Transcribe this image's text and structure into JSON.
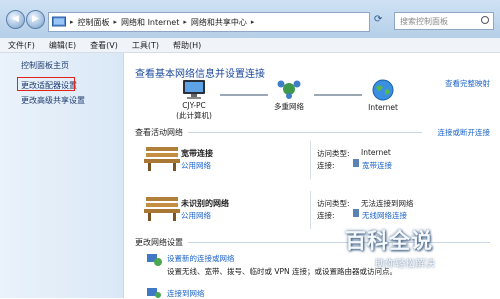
{
  "address_bar": {
    "breadcrumbs": [
      "控制面板",
      "网络和 Internet",
      "网络和共享中心"
    ],
    "search_placeholder": "搜索控制面板"
  },
  "menubar": [
    "文件(F)",
    "编辑(E)",
    "查看(V)",
    "工具(T)",
    "帮助(H)"
  ],
  "sidebar": {
    "items": [
      "控制面板主页",
      "更改适配器设置",
      "更改高级共享设置"
    ]
  },
  "main": {
    "title": "查看基本网络信息并设置连接",
    "full_map_link": "查看完整映射",
    "map": {
      "pc_name": "CJY-PC",
      "pc_sub": "(此计算机)",
      "network": "多重网络",
      "internet": "Internet"
    },
    "active_section": "查看活动网络",
    "connect_link": "连接或断开连接",
    "networks": [
      {
        "name": "宽带连接",
        "type": "公用网络",
        "access_label": "访问类型:",
        "access_value": "Internet",
        "conn_label": "连接:",
        "conn_value": "宽带连接"
      },
      {
        "name": "未识别的网络",
        "type": "公用网络",
        "access_label": "访问类型:",
        "access_value": "无法连接到网络",
        "conn_label": "连接:",
        "conn_value": "无线网络连接"
      }
    ],
    "change_section": "更改网络设置",
    "tasks": [
      {
        "title": "设置新的连接或网络",
        "desc": "设置无线、宽带、拨号、临时或 VPN 连接；或设置路由器或访问点。"
      },
      {
        "title": "连接到网络",
        "desc": ""
      }
    ]
  },
  "watermark": {
    "title": "百科全说",
    "subtitle": "助你轻松解决"
  }
}
